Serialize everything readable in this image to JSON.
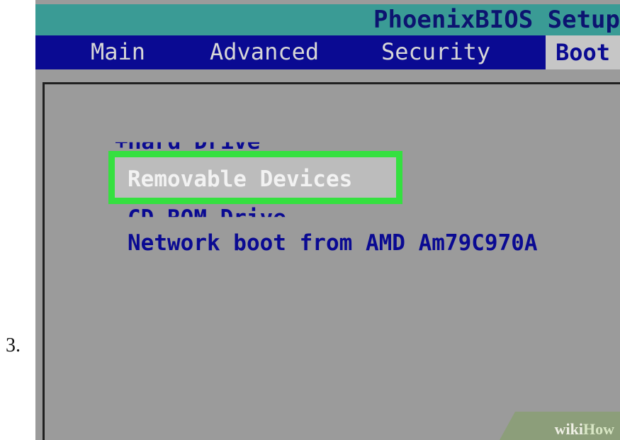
{
  "step_label": "3.",
  "bios": {
    "title": "PhoenixBIOS Setup",
    "menu": [
      {
        "label": "Main"
      },
      {
        "label": "Advanced"
      },
      {
        "label": "Security"
      },
      {
        "label": "Boot",
        "active": true
      }
    ],
    "boot_order": [
      {
        "label": "+Hard Drive"
      },
      {
        "label": "Removable Devices",
        "selected": true
      },
      {
        "label": "CD-ROM Drive"
      },
      {
        "label": "Network boot from AMD Am79C970A"
      }
    ]
  },
  "watermark": {
    "part1": "wiki",
    "part2": "How"
  },
  "colors": {
    "title_bar": "#3a9b95",
    "menu_bar": "#0a0a92",
    "panel_bg": "#9b9b9b",
    "highlight_border": "#35e040",
    "item_text": "#0a0a92"
  }
}
